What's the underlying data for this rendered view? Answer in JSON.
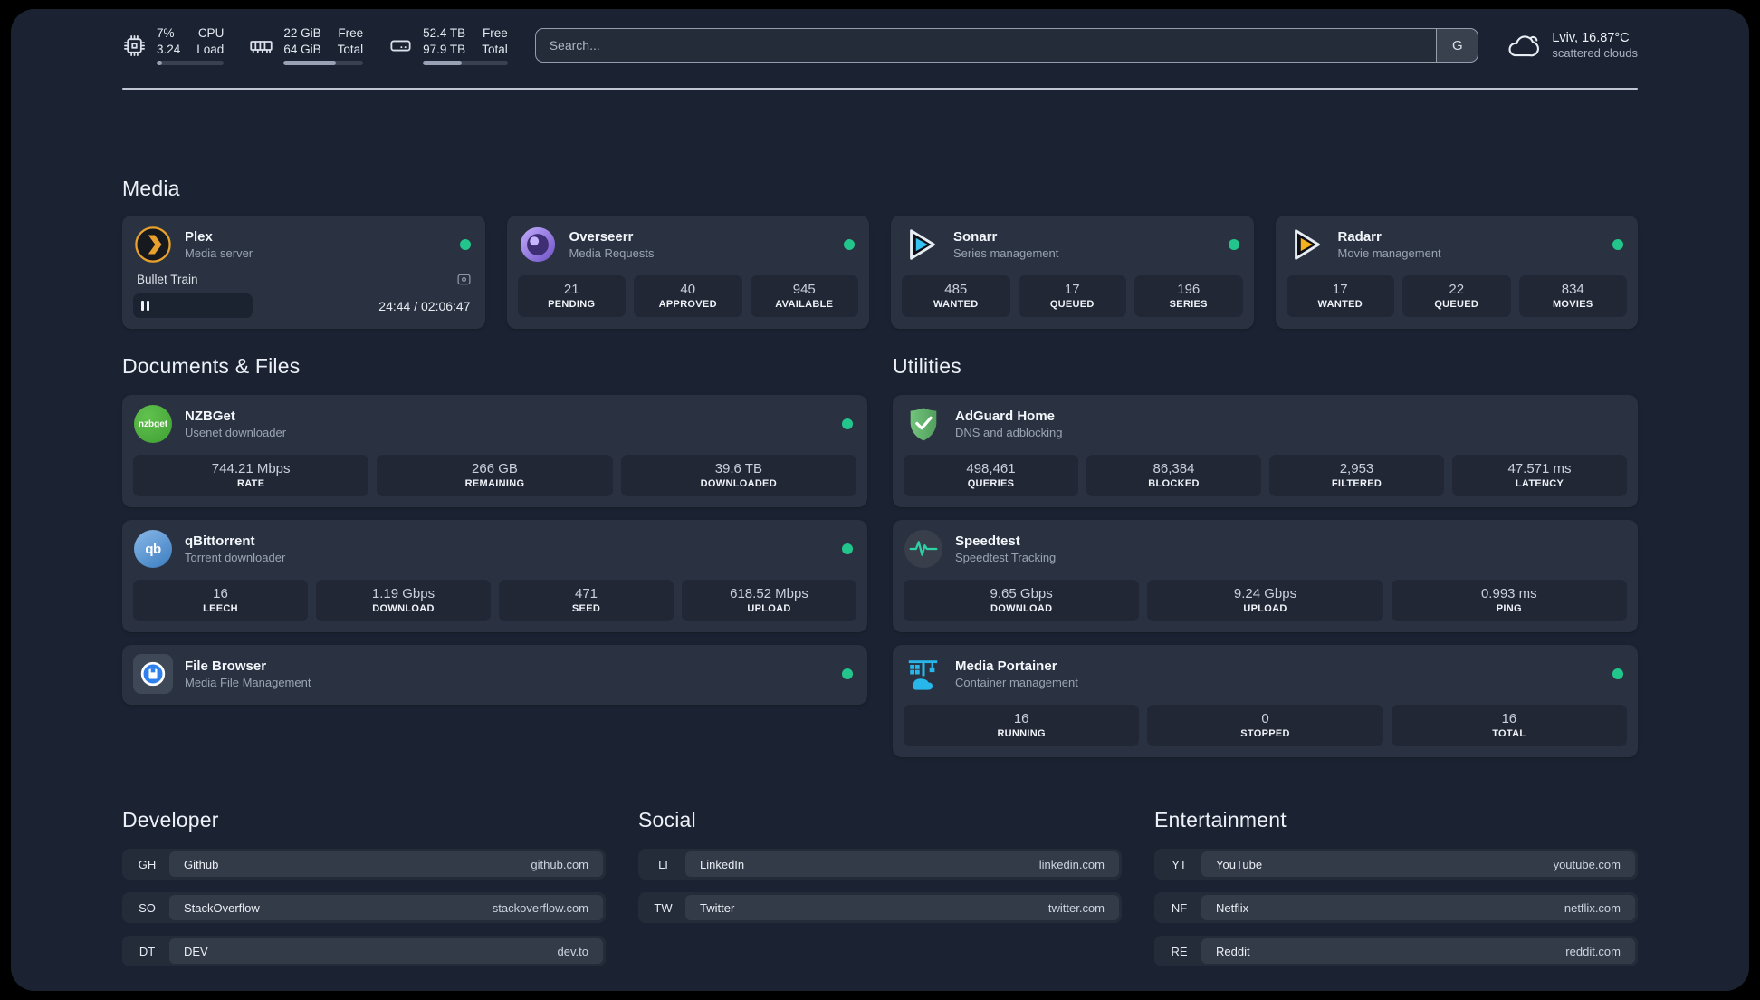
{
  "header": {
    "resources": [
      {
        "icon": "cpu-icon",
        "value1": "7%",
        "value2": "3.24",
        "label1": "CPU",
        "label2": "Load",
        "fill": "width:8%"
      },
      {
        "icon": "memory-icon",
        "value1": "22 GiB",
        "value2": "64 GiB",
        "label1": "Free",
        "label2": "Total",
        "fill": "width:66%"
      },
      {
        "icon": "disk-icon",
        "value1": "52.4 TB",
        "value2": "97.9 TB",
        "label1": "Free",
        "label2": "Total",
        "fill": "width:46%"
      }
    ],
    "search": {
      "placeholder": "Search...",
      "engine_button": "G"
    },
    "weather": {
      "icon": "cloud-icon",
      "location": "Lviv, 16.87°C",
      "condition": "scattered clouds"
    }
  },
  "sections": {
    "media": {
      "title": "Media",
      "cards": [
        {
          "icon": "plex-icon",
          "name": "Plex",
          "description": "Media server",
          "online": true,
          "player": {
            "title": "Bullet Train",
            "time": "24:44 / 02:06:47",
            "track_style": "width:35%"
          }
        },
        {
          "icon": "overseerr-icon",
          "name": "Overseerr",
          "description": "Media Requests",
          "online": true,
          "stats": [
            {
              "value": "21",
              "label": "PENDING"
            },
            {
              "value": "40",
              "label": "APPROVED"
            },
            {
              "value": "945",
              "label": "AVAILABLE"
            }
          ]
        },
        {
          "icon": "sonarr-icon",
          "name": "Sonarr",
          "description": "Series management",
          "online": true,
          "stats": [
            {
              "value": "485",
              "label": "WANTED"
            },
            {
              "value": "17",
              "label": "QUEUED"
            },
            {
              "value": "196",
              "label": "SERIES"
            }
          ]
        },
        {
          "icon": "radarr-icon",
          "name": "Radarr",
          "description": "Movie management",
          "online": true,
          "stats": [
            {
              "value": "17",
              "label": "WANTED"
            },
            {
              "value": "22",
              "label": "QUEUED"
            },
            {
              "value": "834",
              "label": "MOVIES"
            }
          ]
        }
      ]
    },
    "documents": {
      "title": "Documents & Files",
      "cards": [
        {
          "icon": "nzbget-icon",
          "icon_text": "nzbget",
          "name": "NZBGet",
          "description": "Usenet downloader",
          "online": true,
          "stats": [
            {
              "value": "744.21 Mbps",
              "label": "RATE"
            },
            {
              "value": "266 GB",
              "label": "REMAINING"
            },
            {
              "value": "39.6 TB",
              "label": "DOWNLOADED"
            }
          ]
        },
        {
          "icon": "qbittorrent-icon",
          "icon_text": "qb",
          "name": "qBittorrent",
          "description": "Torrent downloader",
          "online": true,
          "stats": [
            {
              "value": "16",
              "label": "LEECH"
            },
            {
              "value": "1.19 Gbps",
              "label": "DOWNLOAD"
            },
            {
              "value": "471",
              "label": "SEED"
            },
            {
              "value": "618.52 Mbps",
              "label": "UPLOAD"
            }
          ]
        },
        {
          "icon": "filebrowser-icon",
          "name": "File Browser",
          "description": "Media File Management",
          "online": true
        }
      ]
    },
    "utilities": {
      "title": "Utilities",
      "cards": [
        {
          "icon": "adguard-icon",
          "name": "AdGuard Home",
          "description": "DNS and adblocking",
          "online": false,
          "stats": [
            {
              "value": "498,461",
              "label": "QUERIES"
            },
            {
              "value": "86,384",
              "label": "BLOCKED"
            },
            {
              "value": "2,953",
              "label": "FILTERED"
            },
            {
              "value": "47.571 ms",
              "label": "LATENCY"
            }
          ]
        },
        {
          "icon": "speedtest-icon",
          "name": "Speedtest",
          "description": "Speedtest Tracking",
          "online": false,
          "stats": [
            {
              "value": "9.65 Gbps",
              "label": "DOWNLOAD"
            },
            {
              "value": "9.24 Gbps",
              "label": "UPLOAD"
            },
            {
              "value": "0.993 ms",
              "label": "PING"
            }
          ]
        },
        {
          "icon": "portainer-icon",
          "name": "Media Portainer",
          "description": "Container management",
          "online": true,
          "stats": [
            {
              "value": "16",
              "label": "RUNNING"
            },
            {
              "value": "0",
              "label": "STOPPED"
            },
            {
              "value": "16",
              "label": "TOTAL"
            }
          ]
        }
      ]
    }
  },
  "bookmarks": [
    {
      "title": "Developer",
      "links": [
        {
          "abbr": "GH",
          "name": "Github",
          "url": "github.com"
        },
        {
          "abbr": "SO",
          "name": "StackOverflow",
          "url": "stackoverflow.com"
        },
        {
          "abbr": "DT",
          "name": "DEV",
          "url": "dev.to"
        }
      ]
    },
    {
      "title": "Social",
      "links": [
        {
          "abbr": "LI",
          "name": "LinkedIn",
          "url": "linkedin.com"
        },
        {
          "abbr": "TW",
          "name": "Twitter",
          "url": "twitter.com"
        }
      ]
    },
    {
      "title": "Entertainment",
      "links": [
        {
          "abbr": "YT",
          "name": "YouTube",
          "url": "youtube.com"
        },
        {
          "abbr": "NF",
          "name": "Netflix",
          "url": "netflix.com"
        },
        {
          "abbr": "RE",
          "name": "Reddit",
          "url": "reddit.com"
        }
      ]
    }
  ],
  "colors": {
    "status_online": "#22c68c",
    "accent_plex": "#e9a12d",
    "accent_sonarr": "#36c3f1",
    "accent_radarr": "#f6b21e"
  }
}
